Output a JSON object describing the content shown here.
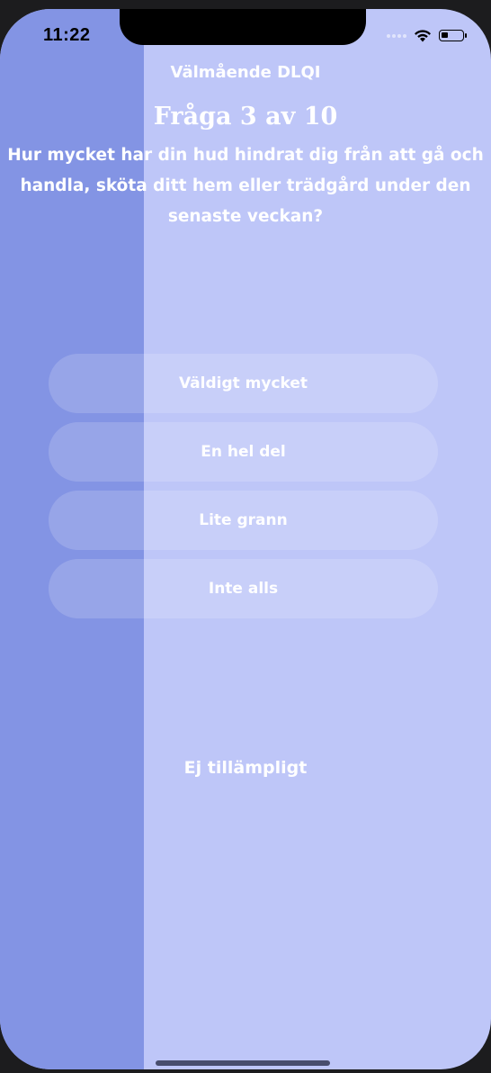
{
  "status_bar": {
    "time": "11:22",
    "icons": [
      "cellular-dots-icon",
      "wifi-icon",
      "battery-icon"
    ],
    "battery_level": 0.35
  },
  "header": {
    "app_title": "Välmående DLQI",
    "question_counter": "Fråga 3 av 10"
  },
  "progress": {
    "fraction": 0.3
  },
  "question": {
    "text": "Hur mycket har din hud hindrat dig från att gå och handla, sköta ditt hem eller trädgård under den senaste veckan?"
  },
  "answers": [
    {
      "label": "Väldigt mycket"
    },
    {
      "label": "En hel del"
    },
    {
      "label": "Lite grann"
    },
    {
      "label": "Inte alls"
    }
  ],
  "not_applicable_label": "Ej tillämpligt",
  "colors": {
    "background": "#bec6f8",
    "progress_fill": "#8394e4",
    "text": "#ffffff"
  }
}
